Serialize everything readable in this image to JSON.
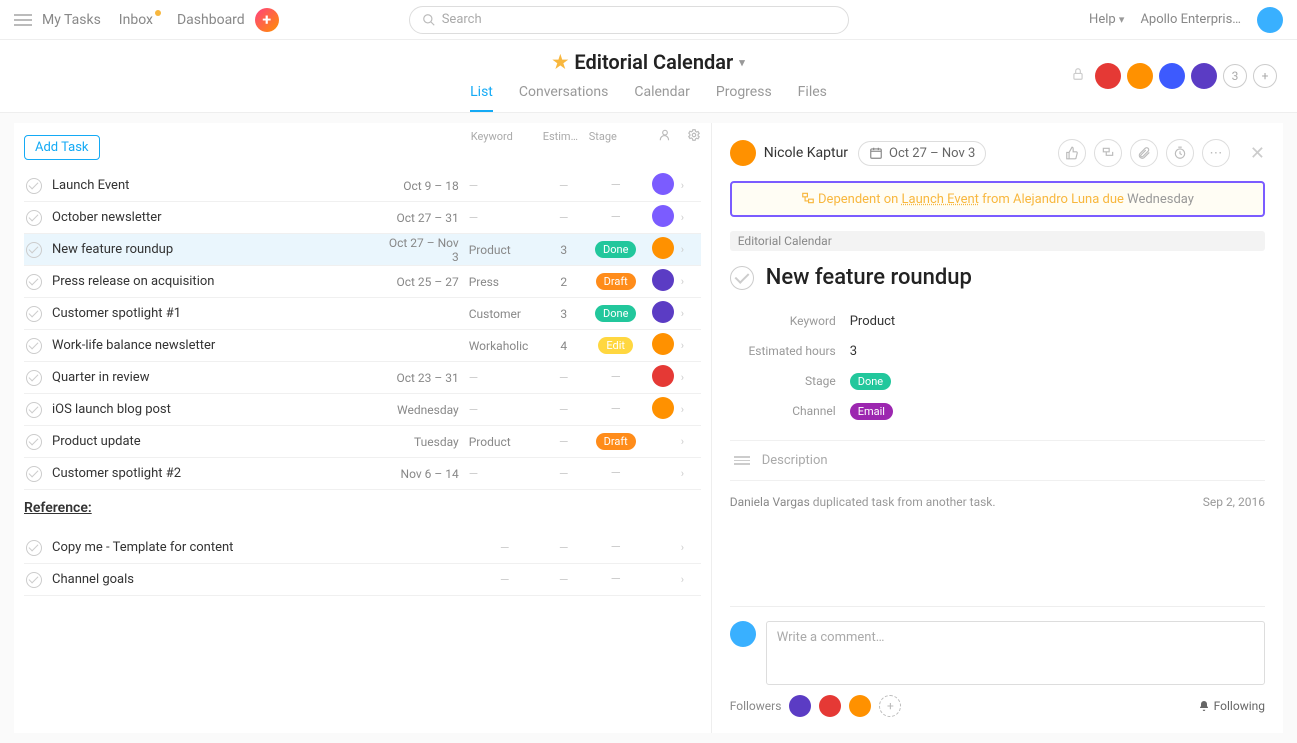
{
  "topbar": {
    "nav": {
      "mytasks": "My Tasks",
      "inbox": "Inbox",
      "dashboard": "Dashboard"
    },
    "search_placeholder": "Search",
    "help": "Help",
    "workspace": "Apollo Enterpris…"
  },
  "project": {
    "title": "Editorial Calendar",
    "tabs": {
      "list": "List",
      "conv": "Conversations",
      "cal": "Calendar",
      "prog": "Progress",
      "files": "Files"
    },
    "member_overflow": "3"
  },
  "list": {
    "add_task": "Add Task",
    "headers": {
      "keyword": "Keyword",
      "estim": "Estim…",
      "stage": "Stage"
    },
    "section_reference": "Reference:",
    "rows": [
      {
        "title": "Launch Event",
        "date": "Oct 9 – 18",
        "kw": "",
        "est": "",
        "stage": "",
        "av": "#7b5cff"
      },
      {
        "title": "October newsletter",
        "date": "Oct 27 – 31",
        "kw": "",
        "est": "",
        "stage": "",
        "av": "#7b5cff"
      },
      {
        "title": "New feature roundup",
        "date": "Oct 27 – Nov 3",
        "kw": "Product",
        "est": "3",
        "stage": "Done",
        "av": "#ff9100",
        "selected": true
      },
      {
        "title": "Press release on acquisition",
        "date": "Oct 25 – 27",
        "kw": "Press",
        "est": "2",
        "stage": "Draft",
        "av": "#5b3cc4"
      },
      {
        "title": "Customer spotlight #1",
        "date": "",
        "kw": "Customer",
        "est": "3",
        "stage": "Done",
        "av": "#5b3cc4"
      },
      {
        "title": "Work-life balance newsletter",
        "date": "",
        "kw": "Workaholic",
        "est": "4",
        "stage": "Edit",
        "av": "#ff9100"
      },
      {
        "title": "Quarter in review",
        "date": "Oct 23 – 31",
        "kw": "",
        "est": "",
        "stage": "",
        "av": "#e53935"
      },
      {
        "title": "iOS launch blog post",
        "date": "Wednesday",
        "kw": "",
        "est": "",
        "stage": "",
        "av": "#ff9100"
      },
      {
        "title": "Product update",
        "date": "Tuesday",
        "kw": "Product",
        "est": "",
        "stage": "Draft",
        "av": ""
      },
      {
        "title": "Customer spotlight #2",
        "date": "Nov 6 – 14",
        "kw": "",
        "est": "",
        "stage": "",
        "av": ""
      }
    ],
    "ref_rows": [
      {
        "title": "Copy me - Template for content"
      },
      {
        "title": "Channel goals"
      }
    ]
  },
  "detail": {
    "assignee": "Nicole Kaptur",
    "date": "Oct 27 – Nov 3",
    "dependency": {
      "pre": "Dependent on",
      "link": "Launch Event",
      "from": "from Alejandro Luna due",
      "due": "Wednesday"
    },
    "project_tag": "Editorial Calendar",
    "title": "New feature roundup",
    "fields": {
      "keyword_label": "Keyword",
      "keyword_value": "Product",
      "est_label": "Estimated hours",
      "est_value": "3",
      "stage_label": "Stage",
      "stage_value": "Done",
      "channel_label": "Channel",
      "channel_value": "Email"
    },
    "description_placeholder": "Description",
    "activity": {
      "who": "Daniela Vargas",
      "what": "duplicated task from another task.",
      "when": "Sep 2, 2016"
    },
    "comment_placeholder": "Write a comment…",
    "followers_label": "Followers",
    "following_label": "Following"
  }
}
